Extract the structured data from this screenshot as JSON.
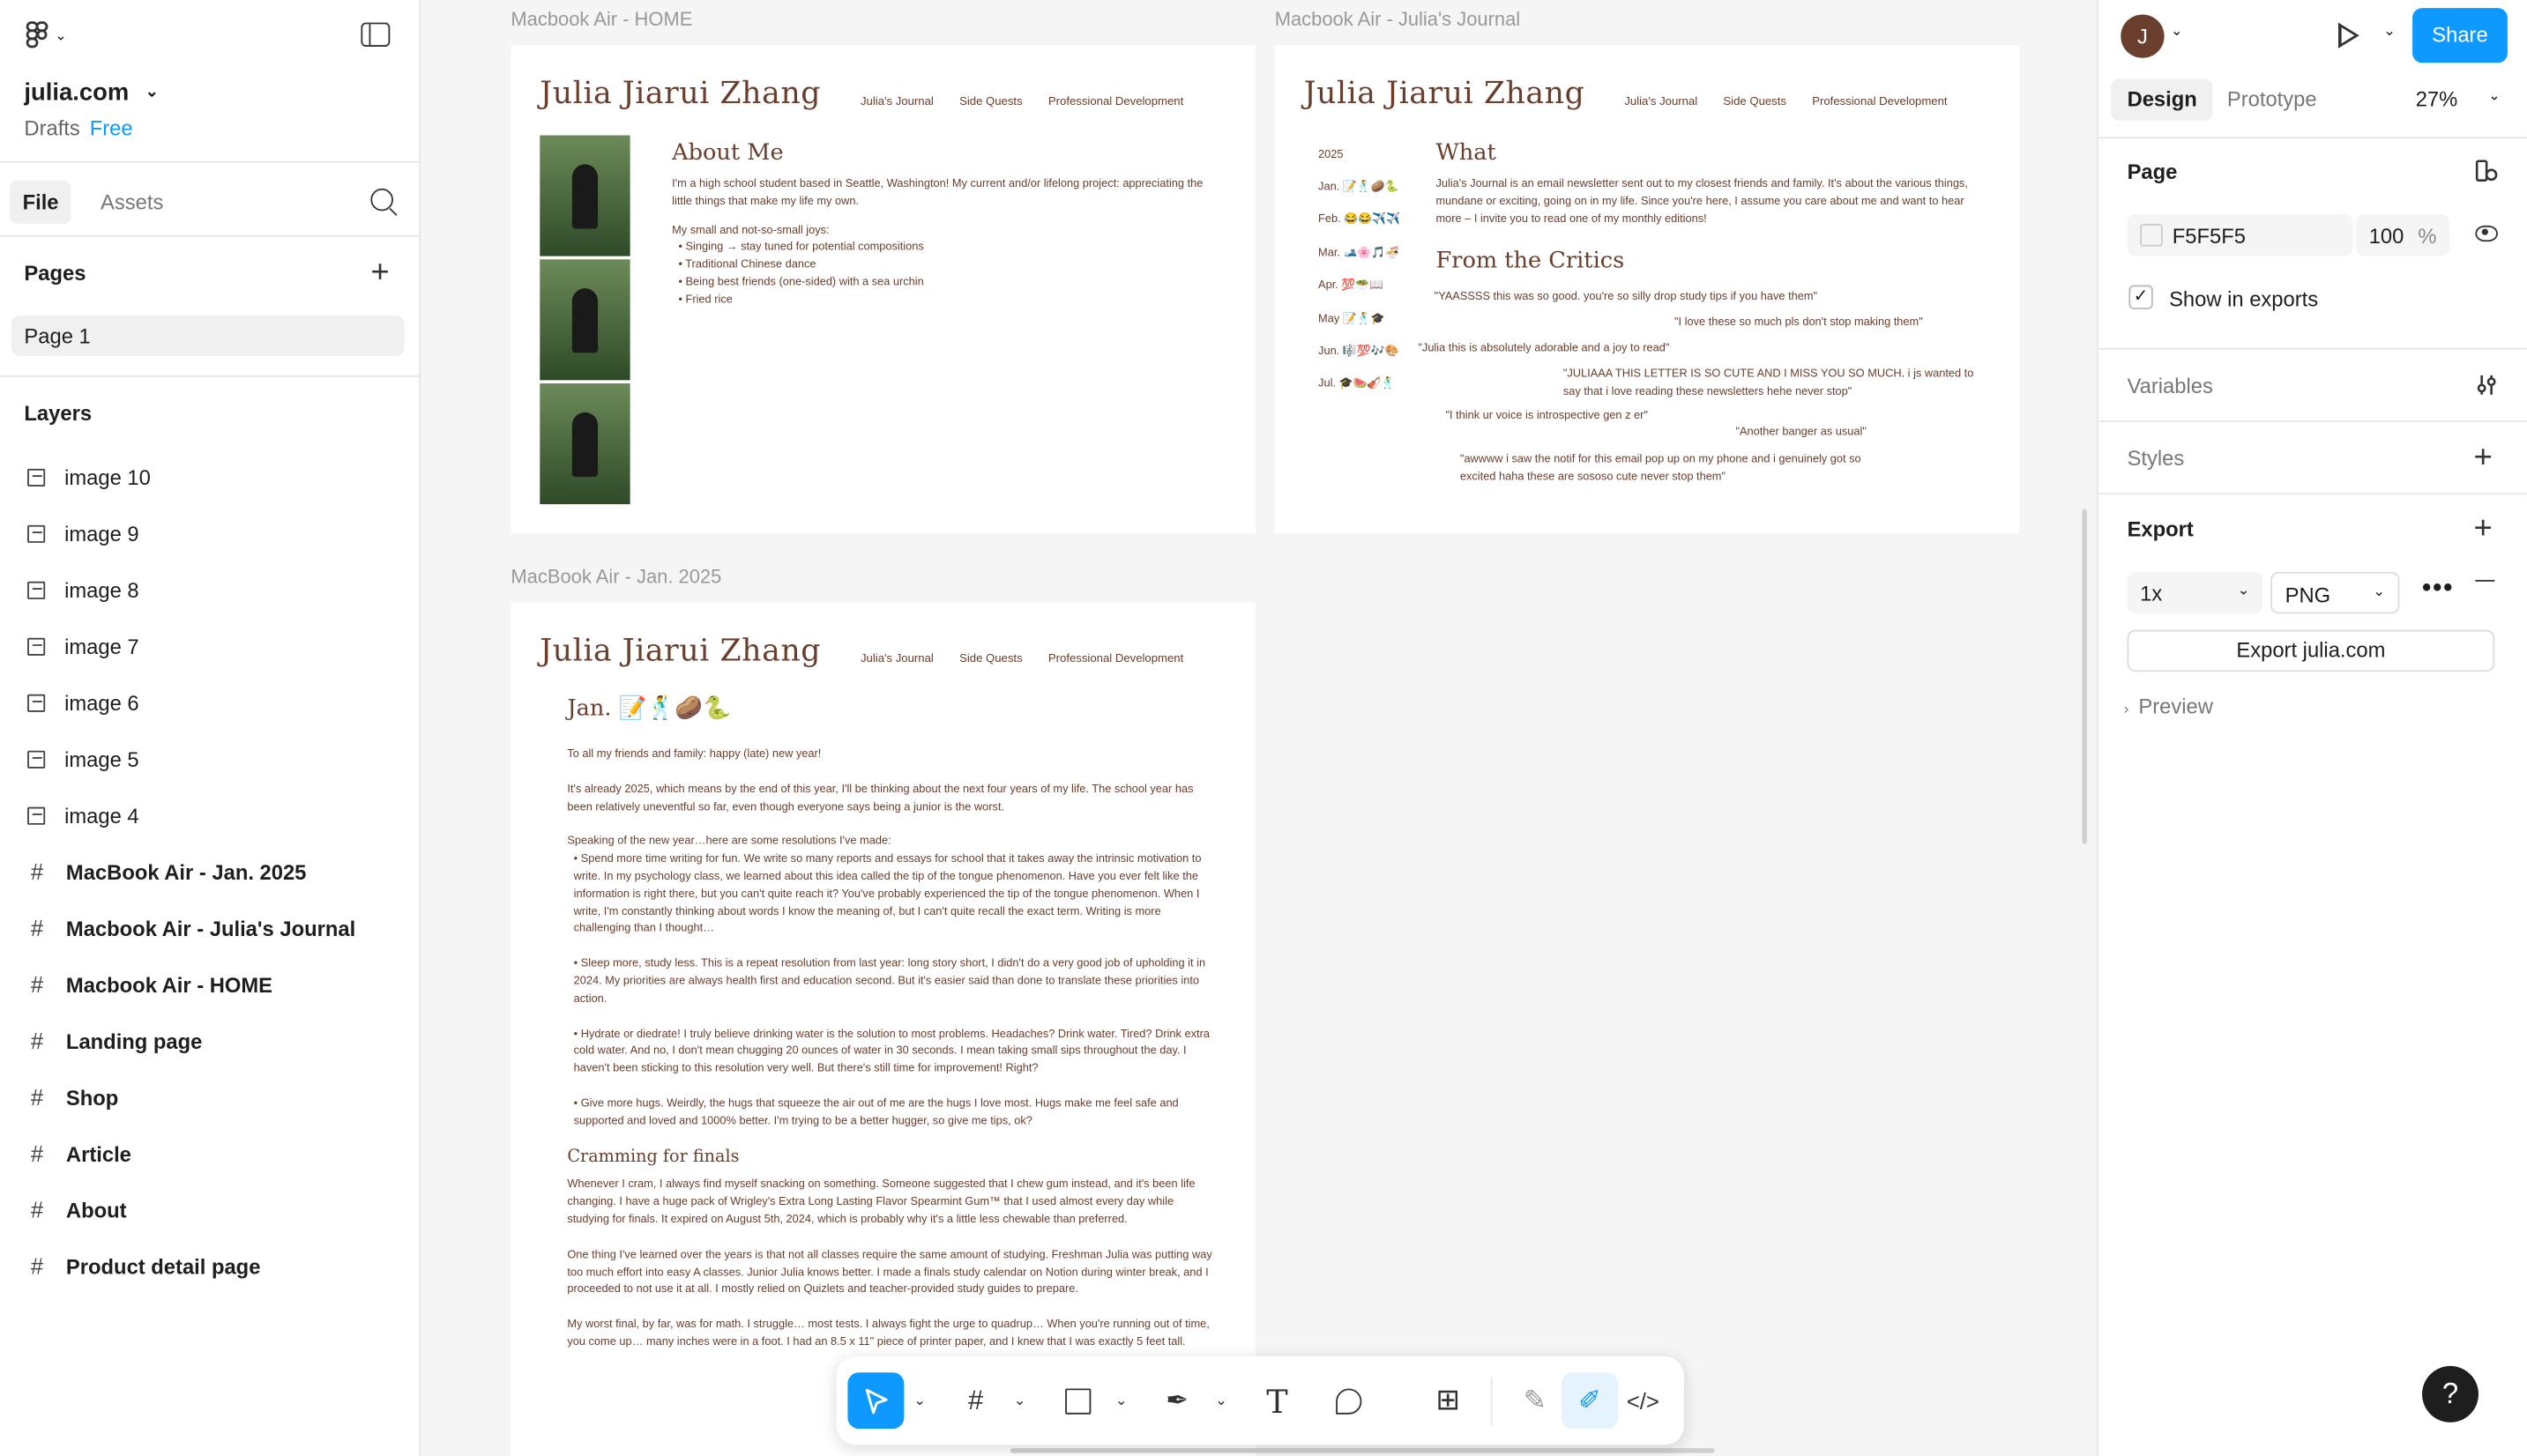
{
  "file": {
    "name": "julia.com",
    "location": "Drafts",
    "plan": "Free"
  },
  "left_tabs": {
    "file": "File",
    "assets": "Assets"
  },
  "pages": {
    "title": "Pages",
    "items": [
      "Page 1"
    ]
  },
  "layers": {
    "title": "Layers",
    "items": [
      {
        "name": "image 10",
        "kind": "image"
      },
      {
        "name": "image 9",
        "kind": "image"
      },
      {
        "name": "image 8",
        "kind": "image"
      },
      {
        "name": "image 7",
        "kind": "image"
      },
      {
        "name": "image 6",
        "kind": "image"
      },
      {
        "name": "image 5",
        "kind": "image"
      },
      {
        "name": "image 4",
        "kind": "image"
      },
      {
        "name": "MacBook Air - Jan. 2025",
        "kind": "frame"
      },
      {
        "name": "Macbook Air - Julia's Journal",
        "kind": "frame"
      },
      {
        "name": "Macbook Air - HOME",
        "kind": "frame"
      },
      {
        "name": "Landing page",
        "kind": "frame"
      },
      {
        "name": "Shop",
        "kind": "frame"
      },
      {
        "name": "Article",
        "kind": "frame"
      },
      {
        "name": "About",
        "kind": "frame"
      },
      {
        "name": "Product detail page",
        "kind": "frame"
      }
    ]
  },
  "frames": {
    "home_label": "Macbook Air - HOME",
    "journal_label": "Macbook Air - Julia's Journal",
    "jan_label": "MacBook Air - Jan. 2025"
  },
  "site": {
    "title": "Julia Jiarui Zhang",
    "nav": [
      "Julia's Journal",
      "Side Quests",
      "Professional Development"
    ]
  },
  "home": {
    "heading": "About Me",
    "intro": "I'm a high school student based in Seattle, Washington! My current and/or lifelong project: appreciating the little things that make my life my own.",
    "joys_heading": "My small and not-so-small joys:",
    "joys": [
      "Singing → stay tuned for potential compositions",
      "Traditional Chinese dance",
      "Being best friends (one-sided) with a sea urchin",
      "Fried rice"
    ]
  },
  "journal": {
    "year": "2025",
    "months": [
      "Jan. 📝🕺🥔🐍",
      "Feb. 😂😂✈️✈️",
      "Mar. 🎿🌸🎵🍜",
      "Apr. 💯🥗📖",
      "May 📝🕺🎓",
      "Jun. 🎼💯🎶🎨",
      "Jul. 🎓🍉🎻🕺"
    ],
    "what_heading": "What",
    "what_text": "Julia's Journal is an email newsletter sent out to my closest friends and family. It's about the various things, mundane or exciting, going on in my life. Since you're here, I assume you care about me and want to hear more – I invite you to read one of my monthly editions!",
    "critics_heading": "From the Critics",
    "quotes": [
      "\"YAASSSS this was so good. you're so silly drop study tips if you have them\"",
      "\"I love these so much pls don't stop making them\"",
      "\"Julia this is absolutely adorable and a joy to read\"",
      "\"JULIAAA THIS LETTER IS SO CUTE AND I MISS YOU SO MUCH. i js wanted to say that i love reading these newsletters hehe never stop\"",
      "\"I think ur voice is introspective gen z er\"",
      "\"Another banger as usual\"",
      "\"awwww i saw the notif for this email pop up on my phone and i genuinely got so excited haha these are sososo cute never stop them\""
    ]
  },
  "jan": {
    "heading": "Jan. 📝🕺🥔🐍",
    "p1": "To all my friends and family: happy (late) new year!",
    "p2": "It's already 2025, which means by the end of this year, I'll be thinking about the next four years of my life. The school year has been relatively uneventful so far, even though everyone says being a junior is the worst.",
    "p3": "Speaking of the new year…here are some resolutions I've made:",
    "bullets": [
      "Spend more time writing for fun. We write so many reports and essays for school that it takes away the intrinsic motivation to write. In my psychology class, we learned about this idea called the tip of the tongue phenomenon. Have you ever felt like the information is right there, but you can't quite reach it? You've probably experienced the tip of the tongue phenomenon. When I write, I'm constantly thinking about words I know the meaning of, but I can't quite recall the exact term. Writing is more challenging than I thought…",
      "Sleep more, study less. This is a repeat resolution from last year: long story short, I didn't do a very good job of upholding it in 2024. My priorities are always health first and education second. But it's easier said than done to translate these priorities into action.",
      "Hydrate or diedrate! I truly believe drinking water is the solution to most problems. Headaches? Drink water. Tired? Drink extra cold water. And no, I don't mean chugging 20 ounces of water in 30 seconds. I mean taking small sips throughout the day. I haven't been sticking to this resolution very well. But there's still time for improvement! Right?",
      "Give more hugs. Weirdly, the hugs that squeeze the air out of me are the hugs I love most. Hugs make me feel safe and supported and loved and 1000% better. I'm trying to be a better hugger, so give me tips, ok?"
    ],
    "cram_heading": "Cramming for finals",
    "p4": "Whenever I cram, I always find myself snacking on something. Someone suggested that I chew gum instead, and it's been life changing. I have a huge pack of Wrigley's Extra Long Lasting Flavor Spearmint Gum™ that I used almost every day while studying for finals. It expired on August 5th, 2024, which is probably why it's a little less chewable than preferred.",
    "p5": "One thing I've learned over the years is that not all classes require the same amount of studying. Freshman Julia was putting way too much effort into easy A classes. Junior Julia knows better. I made a finals study calendar on Notion during winter break, and I proceeded to not use it at all. I mostly relied on Quizlets and teacher-provided study guides to prepare.",
    "p6": "My worst final, by far, was for math. I struggle… most tests. I always fight the urge to quadrup… When you're running out of time, you come up… many inches were in a foot. I had an 8.5 x 11\" piece of printer paper, and I knew that I was exactly 5 feet tall."
  },
  "right": {
    "avatar_letter": "J",
    "share_label": "Share",
    "tabs": [
      "Design",
      "Prototype"
    ],
    "zoom": "27%",
    "page_section": "Page",
    "bg_color": "F5F5F5",
    "bg_opacity": "100",
    "percent": "%",
    "show_in_exports": "Show in exports",
    "variables": "Variables",
    "styles": "Styles",
    "export": "Export",
    "export_scale": "1x",
    "export_format": "PNG",
    "export_button": "Export julia.com",
    "preview": "Preview"
  },
  "help_label": "?"
}
